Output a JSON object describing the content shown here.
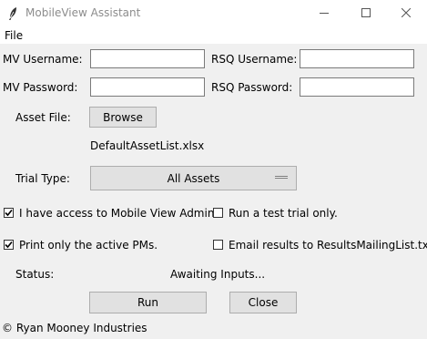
{
  "window": {
    "title": "MobileView Assistant",
    "icons": {
      "app": "feather-icon",
      "minimize": "minimize-icon",
      "maximize": "maximize-icon",
      "close": "close-icon"
    }
  },
  "menu": {
    "file": "File"
  },
  "form": {
    "mv_username_label": "MV Username:",
    "mv_username_value": "",
    "rsq_username_label": "RSQ Username:",
    "rsq_username_value": "",
    "mv_password_label": "MV Password:",
    "mv_password_value": "",
    "rsq_password_label": "RSQ Password:",
    "rsq_password_value": "",
    "asset_file_label": "Asset File:",
    "browse_label": "Browse",
    "asset_file_name": "DefaultAssetList.xlsx",
    "trial_type_label": "Trial Type:",
    "trial_type_value": "All Assets"
  },
  "options": {
    "admin_access": {
      "label": "I have access to Mobile View Admin.",
      "checked": true
    },
    "test_trial": {
      "label": "Run a test trial only.",
      "checked": false
    },
    "active_pms": {
      "label": "Print only the active PMs.",
      "checked": true
    },
    "email_results": {
      "label": "Email results to ResultsMailingList.txt.",
      "checked": false
    }
  },
  "status": {
    "label": "Status:",
    "value": "Awaiting Inputs..."
  },
  "actions": {
    "run_label": "Run",
    "close_label": "Close"
  },
  "footer": {
    "copyright": "© Ryan Mooney Industries"
  }
}
